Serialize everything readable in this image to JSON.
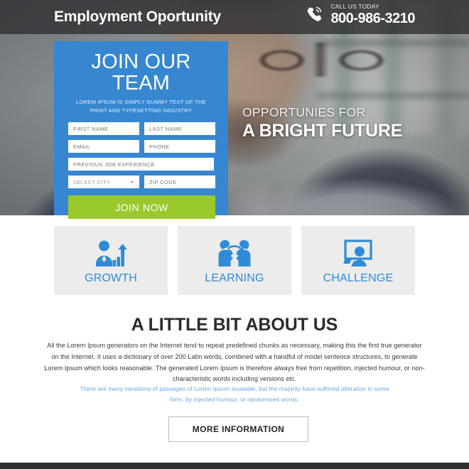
{
  "header": {
    "brand": "Employment Oportunity",
    "call_label": "CALL US TODAY",
    "call_number": "800-986-3210",
    "phone_icon": "phone-call-icon"
  },
  "hero": {
    "headline_line1": "OPPORTUNIES FOR",
    "headline_line2": "A BRIGHT FUTURE"
  },
  "form": {
    "title": "JOIN OUR TEAM",
    "subtitle": "LOREM IPSUM IS SIMPLY DUMMY TEXT OF THE PRINT AND TYPESETTING INDUSTRY",
    "fields": {
      "first_name": "FIRST NAME",
      "last_name": "LAST NAME",
      "email": "EMAIL",
      "phone": "PHONE",
      "experience": "PREVIOUS JOB EXPERIENCE",
      "city": "SELECT CITY",
      "zip": "ZIP CODE"
    },
    "submit_label": "JOIN NOW",
    "accent_color": "#3787d0",
    "button_color": "#9ac92b"
  },
  "features": [
    {
      "label": "GROWTH",
      "icon": "growth-chart-person-icon"
    },
    {
      "label": "LEARNING",
      "icon": "knowledge-transfer-heads-icon"
    },
    {
      "label": "CHALLENGE",
      "icon": "presenter-whiteboard-icon"
    }
  ],
  "about": {
    "title": "A LITTLE BIT ABOUT US",
    "body": "All the Lorem Ipsum generators on the Internet tend to repeat predefined chunks as necessary, making this the first true generator on the Internet. It uses a dictionary of over 200 Latin words, combined with a handful of model sentence structures, to generate Lorem Ipsum which looks reasonable. The generated Lorem Ipsum is therefore always free from repetition, injected humour, or non-characteristic words including versions etc.",
    "note": "There are many variations of passages of Lorem Ipsum available, but the majority have suffered alteration in some form, by injected humour, or randomised words.",
    "note_color": "#6aa9e0",
    "cta_label": "MORE INFORMATION"
  }
}
